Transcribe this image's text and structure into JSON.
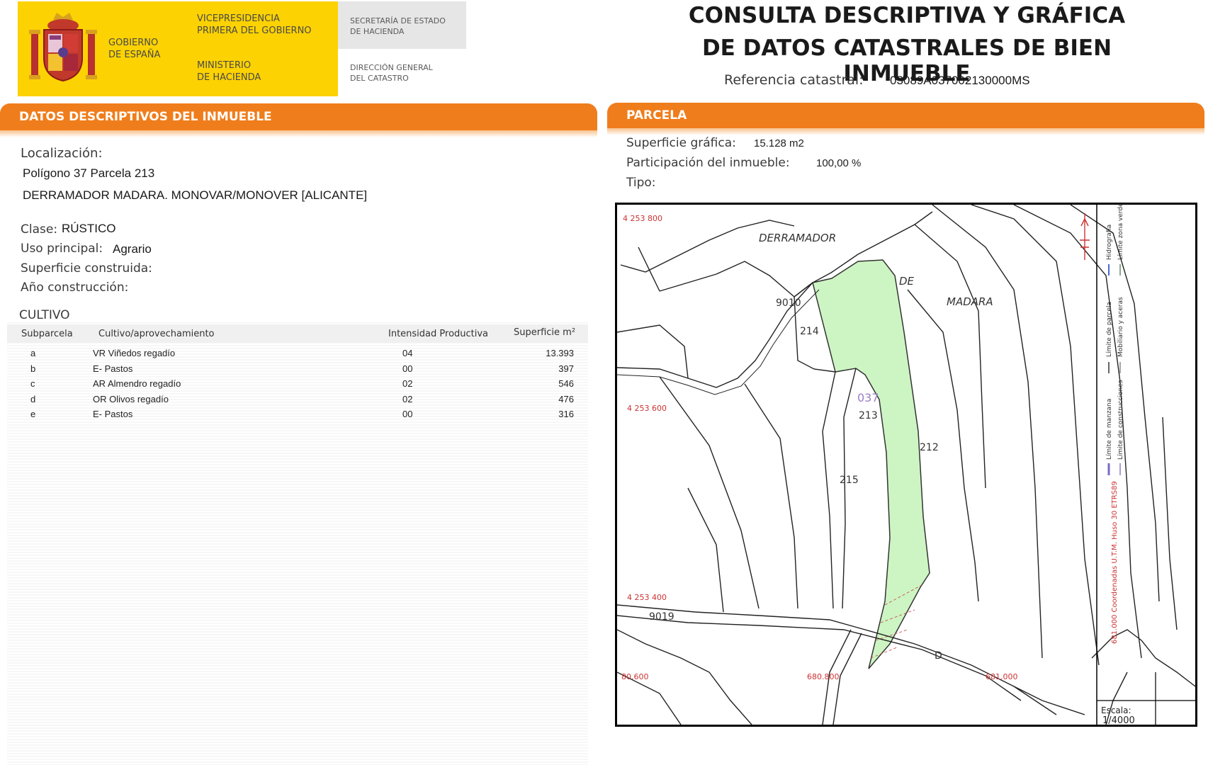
{
  "header": {
    "gov_line1": "GOBIERNO",
    "gov_line2": "DE ESPAÑA",
    "vice_line1": "VICEPRESIDENCIA",
    "vice_line2": "PRIMERA DEL GOBIERNO",
    "min_line1": "MINISTERIO",
    "min_line2": "DE HACIENDA",
    "sec_line1": "SECRETARÍA DE ESTADO",
    "sec_line2": "DE HACIENDA",
    "dir_line1": "DIRECCIÓN GENERAL",
    "dir_line2": "DEL CATASTRO",
    "title_line1": "CONSULTA DESCRIPTIVA Y GRÁFICA",
    "title_line2": "DE DATOS CATASTRALES DE BIEN INMUEBLE",
    "ref_label": "Referencia catastral:",
    "ref_value": "03089A037002130000MS",
    "colors": {
      "yellow": "#fcd202",
      "grey": "#e6e6e6",
      "orange": "#f07d1b"
    }
  },
  "left": {
    "section_title": "DATOS DESCRIPTIVOS DEL INMUEBLE",
    "loc_label": "Localización:",
    "loc_line1": "Polígono 37 Parcela 213",
    "loc_line2": "DERRAMADOR MADARA. MONOVAR/MONOVER [ALICANTE]",
    "clase_label": "Clase:",
    "clase_value": "RÚSTICO",
    "uso_label": "Uso principal:",
    "uso_value": "Agrario",
    "sup_label": "Superficie construida:",
    "anio_label": "Año construcción:",
    "cultivo_title": "CULTIVO",
    "columns": [
      "Subparcela",
      "Cultivo/aprovechamiento",
      "Intensidad Productiva",
      "Superficie m²"
    ],
    "rows": [
      [
        "a",
        "VR Viñedos regadío",
        "04",
        "13.393"
      ],
      [
        "b",
        "E- Pastos",
        "00",
        "397"
      ],
      [
        "c",
        "AR Almendro regadío",
        "02",
        "546"
      ],
      [
        "d",
        "OR Olivos regadío",
        "02",
        "476"
      ],
      [
        "e",
        "E- Pastos",
        "00",
        "316"
      ]
    ]
  },
  "right": {
    "section_title": "PARCELA",
    "sup_label": "Superficie gráfica:",
    "sup_value": "15.128 m2",
    "part_label": "Participación del inmueble:",
    "part_value": "100,00 %",
    "tipo_label": "Tipo:",
    "map": {
      "place_labels": [
        "DERRAMADOR",
        "DE",
        "MADARA"
      ],
      "parcel_labels": [
        "214",
        "213",
        "212",
        "215",
        "037"
      ],
      "road_labels": [
        "9010",
        "9019",
        "D"
      ],
      "coord_labels": [
        "4 253 800",
        "4 253 600",
        "4 253 400",
        "80.600",
        "680.800",
        "681.000"
      ],
      "legend": [
        "Límite de manzana",
        "Límite de parcela",
        "Hidrografía",
        "Límite de construcciones",
        "Mobiliario y aceras",
        "Límite zona verde"
      ],
      "coords_note": "681.000 Coordenadas U.T.M. Huso 30 ETRS89",
      "scale_label": "Escala:",
      "scale_value": "1/4000",
      "highlight_color": "#cdf5c3"
    }
  }
}
